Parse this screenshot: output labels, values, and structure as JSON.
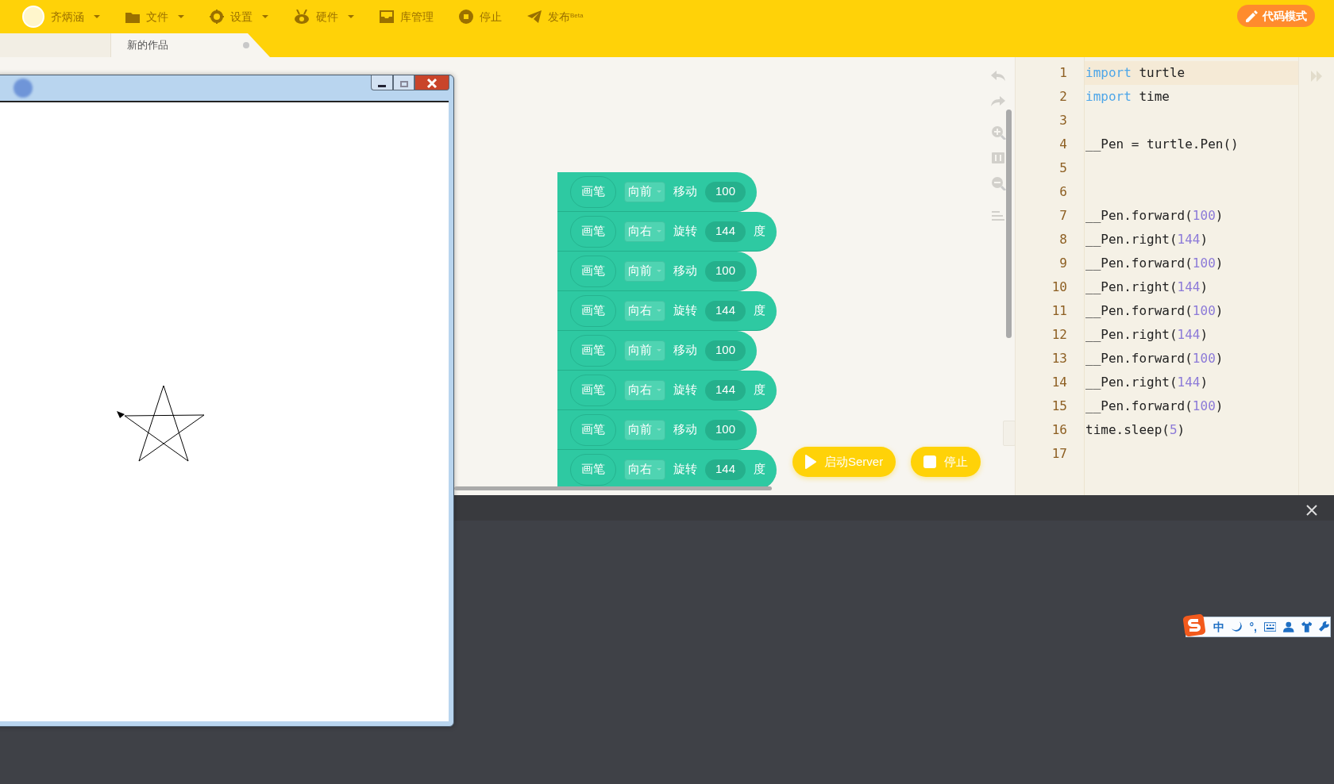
{
  "menu": [
    {
      "kind": "user",
      "label": "齐炳涵",
      "dropdown": true
    },
    {
      "kind": "folder",
      "label": "文件",
      "dropdown": true
    },
    {
      "kind": "gear",
      "label": "设置",
      "dropdown": true
    },
    {
      "kind": "hardware",
      "label": "硬件",
      "dropdown": true
    },
    {
      "kind": "inbox",
      "label": "库管理",
      "dropdown": false
    },
    {
      "kind": "stop",
      "label": "停止",
      "dropdown": false
    },
    {
      "kind": "send",
      "label": "发布$^{Beta}$",
      "dropdown": false
    }
  ],
  "code_mode_button": {
    "label": "代码模式"
  },
  "tabs": [
    {
      "label": "新的作品",
      "selected": true,
      "modified": true
    }
  ],
  "blocks": [
    {
      "kind": "move",
      "target": "画笔",
      "direction": "向前",
      "action": "移动",
      "value": "100"
    },
    {
      "kind": "turn",
      "target": "画笔",
      "direction": "向右",
      "action": "旋转",
      "value": "144",
      "unit": "度"
    },
    {
      "kind": "move",
      "target": "画笔",
      "direction": "向前",
      "action": "移动",
      "value": "100"
    },
    {
      "kind": "turn",
      "target": "画笔",
      "direction": "向右",
      "action": "旋转",
      "value": "144",
      "unit": "度"
    },
    {
      "kind": "move",
      "target": "画笔",
      "direction": "向前",
      "action": "移动",
      "value": "100"
    },
    {
      "kind": "turn",
      "target": "画笔",
      "direction": "向右",
      "action": "旋转",
      "value": "144",
      "unit": "度"
    },
    {
      "kind": "move",
      "target": "画笔",
      "direction": "向前",
      "action": "移动",
      "value": "100"
    },
    {
      "kind": "turn",
      "target": "画笔",
      "direction": "向右",
      "action": "旋转",
      "value": "144",
      "unit": "度"
    }
  ],
  "run_buttons": [
    {
      "kind": "play",
      "label": "启动Server"
    },
    {
      "kind": "stop",
      "label": "停止"
    }
  ],
  "editor": {
    "lines": [
      {
        "number": "1",
        "highlighted": true,
        "tokens": [
          {
            "kind": "keyword",
            "text": "import"
          },
          {
            "kind": "plain",
            "text": " turtle"
          }
        ]
      },
      {
        "number": "2",
        "highlighted": false,
        "tokens": [
          {
            "kind": "keyword",
            "text": "import"
          },
          {
            "kind": "plain",
            "text": " time"
          }
        ]
      },
      {
        "number": "3",
        "highlighted": false
      },
      {
        "number": "4",
        "highlighted": false,
        "tokens": [
          {
            "kind": "plain",
            "text": "__Pen = turtle.Pen()"
          }
        ]
      },
      {
        "number": "5",
        "highlighted": false
      },
      {
        "number": "6",
        "highlighted": false
      },
      {
        "number": "7",
        "highlighted": false,
        "tokens": [
          {
            "kind": "plain",
            "text": "__Pen.forward("
          },
          {
            "kind": "number",
            "text": "100"
          },
          {
            "kind": "plain",
            "text": ")"
          }
        ]
      },
      {
        "number": "8",
        "highlighted": false,
        "tokens": [
          {
            "kind": "plain",
            "text": "__Pen.right("
          },
          {
            "kind": "number",
            "text": "144"
          },
          {
            "kind": "plain",
            "text": ")"
          }
        ]
      },
      {
        "number": "9",
        "highlighted": false,
        "tokens": [
          {
            "kind": "plain",
            "text": "__Pen.forward("
          },
          {
            "kind": "number",
            "text": "100"
          },
          {
            "kind": "plain",
            "text": ")"
          }
        ]
      },
      {
        "number": "10",
        "highlighted": false,
        "tokens": [
          {
            "kind": "plain",
            "text": "__Pen.right("
          },
          {
            "kind": "number",
            "text": "144"
          },
          {
            "kind": "plain",
            "text": ")"
          }
        ]
      },
      {
        "number": "11",
        "highlighted": false,
        "tokens": [
          {
            "kind": "plain",
            "text": "__Pen.forward("
          },
          {
            "kind": "number",
            "text": "100"
          },
          {
            "kind": "plain",
            "text": ")"
          }
        ]
      },
      {
        "number": "12",
        "highlighted": false,
        "tokens": [
          {
            "kind": "plain",
            "text": "__Pen.right("
          },
          {
            "kind": "number",
            "text": "144"
          },
          {
            "kind": "plain",
            "text": ")"
          }
        ]
      },
      {
        "number": "13",
        "highlighted": false,
        "tokens": [
          {
            "kind": "plain",
            "text": "__Pen.forward("
          },
          {
            "kind": "number",
            "text": "100"
          },
          {
            "kind": "plain",
            "text": ")"
          }
        ]
      },
      {
        "number": "14",
        "highlighted": false,
        "tokens": [
          {
            "kind": "plain",
            "text": "__Pen.right("
          },
          {
            "kind": "number",
            "text": "144"
          },
          {
            "kind": "plain",
            "text": ")"
          }
        ]
      },
      {
        "number": "15",
        "highlighted": false,
        "tokens": [
          {
            "kind": "plain",
            "text": "__Pen.forward("
          },
          {
            "kind": "number",
            "text": "100"
          },
          {
            "kind": "plain",
            "text": ")"
          }
        ]
      },
      {
        "number": "16",
        "highlighted": false,
        "tokens": [
          {
            "kind": "plain",
            "text": "time.sleep("
          },
          {
            "kind": "number",
            "text": "5"
          },
          {
            "kind": "plain",
            "text": ")"
          }
        ]
      },
      {
        "number": "17",
        "highlighted": false
      }
    ]
  },
  "ime_toolbar": {
    "mode": "中",
    "punctuation": "°,"
  }
}
